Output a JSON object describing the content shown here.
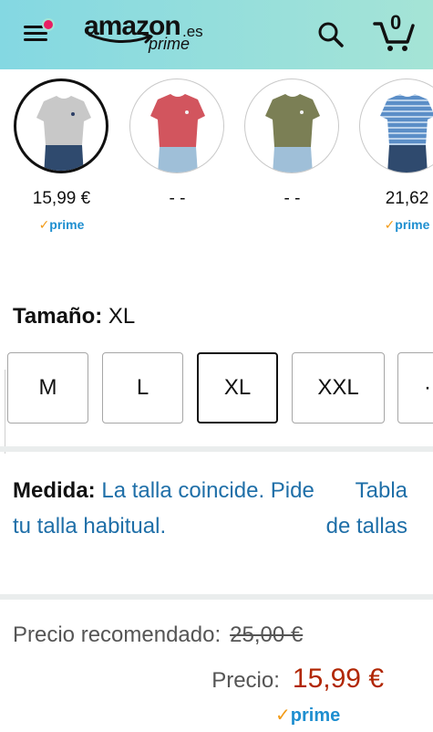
{
  "header": {
    "logo_main": "amazon",
    "logo_tld": ".es",
    "logo_sub": "prime",
    "cart_count": "0",
    "colors": {
      "gradient_start": "#84d8e2",
      "gradient_end": "#a5e4d6",
      "notification_dot": "#e91e63"
    },
    "icons": [
      "menu-icon",
      "search-icon",
      "cart-icon"
    ]
  },
  "swatches": [
    {
      "price": "15,99 €",
      "prime": "prime",
      "shirt_color": "#c8c8c8",
      "selected": true
    },
    {
      "price": "- -",
      "prime": "",
      "shirt_color": "#d2555e",
      "selected": false
    },
    {
      "price": "- -",
      "prime": "",
      "shirt_color": "#7b7f55",
      "selected": false
    },
    {
      "price": "21,62",
      "prime": "prime",
      "shirt_color": "#5b8ec7",
      "selected": false
    }
  ],
  "size": {
    "label": "Tamaño:",
    "value": "XL",
    "options": [
      "M",
      "L",
      "XL",
      "XXL"
    ],
    "selected": "XL"
  },
  "measure": {
    "label": "Medida:",
    "text": "La talla coincide. Pide tu talla habitual.",
    "chart_link": "Tabla de tallas"
  },
  "pricing": {
    "recommended_label": "Precio recomendado:",
    "recommended_value": "25,00 €",
    "price_label": "Precio:",
    "price_value": "15,99 €",
    "prime": "prime",
    "colors": {
      "price": "#b12704",
      "prime": "#1f8fd0",
      "prime_check": "#f29b18",
      "link": "#1f6fa8"
    }
  }
}
